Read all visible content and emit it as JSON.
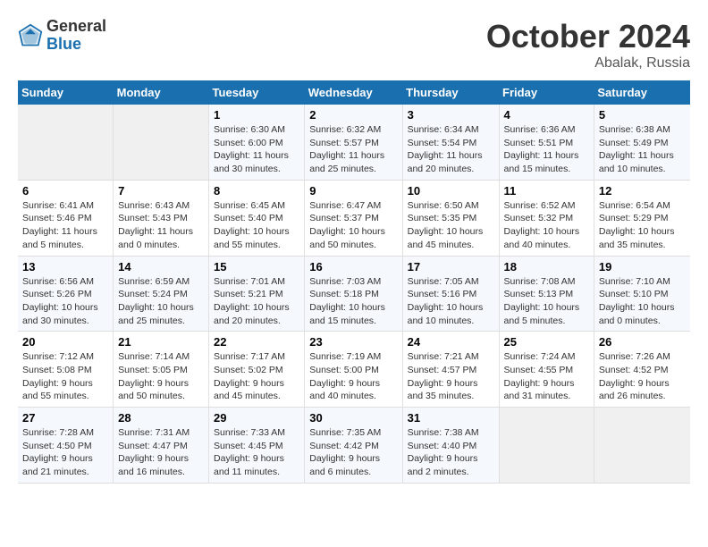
{
  "header": {
    "logo_general": "General",
    "logo_blue": "Blue",
    "month_title": "October 2024",
    "location": "Abalak, Russia"
  },
  "weekdays": [
    "Sunday",
    "Monday",
    "Tuesday",
    "Wednesday",
    "Thursday",
    "Friday",
    "Saturday"
  ],
  "weeks": [
    [
      {
        "day": "",
        "info": ""
      },
      {
        "day": "",
        "info": ""
      },
      {
        "day": "1",
        "info": "Sunrise: 6:30 AM\nSunset: 6:00 PM\nDaylight: 11 hours and 30 minutes."
      },
      {
        "day": "2",
        "info": "Sunrise: 6:32 AM\nSunset: 5:57 PM\nDaylight: 11 hours and 25 minutes."
      },
      {
        "day": "3",
        "info": "Sunrise: 6:34 AM\nSunset: 5:54 PM\nDaylight: 11 hours and 20 minutes."
      },
      {
        "day": "4",
        "info": "Sunrise: 6:36 AM\nSunset: 5:51 PM\nDaylight: 11 hours and 15 minutes."
      },
      {
        "day": "5",
        "info": "Sunrise: 6:38 AM\nSunset: 5:49 PM\nDaylight: 11 hours and 10 minutes."
      }
    ],
    [
      {
        "day": "6",
        "info": "Sunrise: 6:41 AM\nSunset: 5:46 PM\nDaylight: 11 hours and 5 minutes."
      },
      {
        "day": "7",
        "info": "Sunrise: 6:43 AM\nSunset: 5:43 PM\nDaylight: 11 hours and 0 minutes."
      },
      {
        "day": "8",
        "info": "Sunrise: 6:45 AM\nSunset: 5:40 PM\nDaylight: 10 hours and 55 minutes."
      },
      {
        "day": "9",
        "info": "Sunrise: 6:47 AM\nSunset: 5:37 PM\nDaylight: 10 hours and 50 minutes."
      },
      {
        "day": "10",
        "info": "Sunrise: 6:50 AM\nSunset: 5:35 PM\nDaylight: 10 hours and 45 minutes."
      },
      {
        "day": "11",
        "info": "Sunrise: 6:52 AM\nSunset: 5:32 PM\nDaylight: 10 hours and 40 minutes."
      },
      {
        "day": "12",
        "info": "Sunrise: 6:54 AM\nSunset: 5:29 PM\nDaylight: 10 hours and 35 minutes."
      }
    ],
    [
      {
        "day": "13",
        "info": "Sunrise: 6:56 AM\nSunset: 5:26 PM\nDaylight: 10 hours and 30 minutes."
      },
      {
        "day": "14",
        "info": "Sunrise: 6:59 AM\nSunset: 5:24 PM\nDaylight: 10 hours and 25 minutes."
      },
      {
        "day": "15",
        "info": "Sunrise: 7:01 AM\nSunset: 5:21 PM\nDaylight: 10 hours and 20 minutes."
      },
      {
        "day": "16",
        "info": "Sunrise: 7:03 AM\nSunset: 5:18 PM\nDaylight: 10 hours and 15 minutes."
      },
      {
        "day": "17",
        "info": "Sunrise: 7:05 AM\nSunset: 5:16 PM\nDaylight: 10 hours and 10 minutes."
      },
      {
        "day": "18",
        "info": "Sunrise: 7:08 AM\nSunset: 5:13 PM\nDaylight: 10 hours and 5 minutes."
      },
      {
        "day": "19",
        "info": "Sunrise: 7:10 AM\nSunset: 5:10 PM\nDaylight: 10 hours and 0 minutes."
      }
    ],
    [
      {
        "day": "20",
        "info": "Sunrise: 7:12 AM\nSunset: 5:08 PM\nDaylight: 9 hours and 55 minutes."
      },
      {
        "day": "21",
        "info": "Sunrise: 7:14 AM\nSunset: 5:05 PM\nDaylight: 9 hours and 50 minutes."
      },
      {
        "day": "22",
        "info": "Sunrise: 7:17 AM\nSunset: 5:02 PM\nDaylight: 9 hours and 45 minutes."
      },
      {
        "day": "23",
        "info": "Sunrise: 7:19 AM\nSunset: 5:00 PM\nDaylight: 9 hours and 40 minutes."
      },
      {
        "day": "24",
        "info": "Sunrise: 7:21 AM\nSunset: 4:57 PM\nDaylight: 9 hours and 35 minutes."
      },
      {
        "day": "25",
        "info": "Sunrise: 7:24 AM\nSunset: 4:55 PM\nDaylight: 9 hours and 31 minutes."
      },
      {
        "day": "26",
        "info": "Sunrise: 7:26 AM\nSunset: 4:52 PM\nDaylight: 9 hours and 26 minutes."
      }
    ],
    [
      {
        "day": "27",
        "info": "Sunrise: 7:28 AM\nSunset: 4:50 PM\nDaylight: 9 hours and 21 minutes."
      },
      {
        "day": "28",
        "info": "Sunrise: 7:31 AM\nSunset: 4:47 PM\nDaylight: 9 hours and 16 minutes."
      },
      {
        "day": "29",
        "info": "Sunrise: 7:33 AM\nSunset: 4:45 PM\nDaylight: 9 hours and 11 minutes."
      },
      {
        "day": "30",
        "info": "Sunrise: 7:35 AM\nSunset: 4:42 PM\nDaylight: 9 hours and 6 minutes."
      },
      {
        "day": "31",
        "info": "Sunrise: 7:38 AM\nSunset: 4:40 PM\nDaylight: 9 hours and 2 minutes."
      },
      {
        "day": "",
        "info": ""
      },
      {
        "day": "",
        "info": ""
      }
    ]
  ]
}
